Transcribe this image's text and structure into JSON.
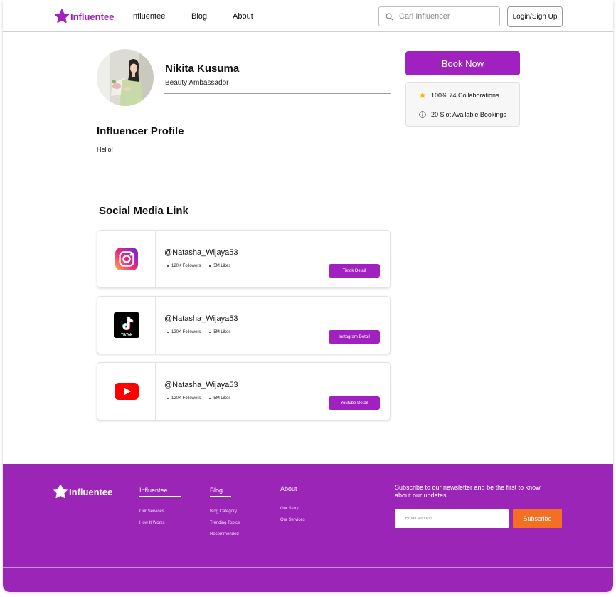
{
  "brand": {
    "name": "Influentee",
    "accent": "#a020c0",
    "footer_bg": "#9b25b6",
    "cta": "#f36f23"
  },
  "nav": {
    "items": [
      "Influentee",
      "Blog",
      "About"
    ]
  },
  "search": {
    "placeholder": "Cari Influencer",
    "icon": "search-icon"
  },
  "auth": {
    "login_label": "Login/Sign Up"
  },
  "profile": {
    "name": "Nikita Kusuma",
    "role": "Beauty Ambassador",
    "section_title": "Influencer Profile",
    "bio": "Hello!"
  },
  "booking": {
    "button_label": "Book Now",
    "stats": [
      {
        "icon": "star-icon",
        "text": "100% 74 Collaborations"
      },
      {
        "icon": "info-icon",
        "text": "20 Slot Available Bookings"
      }
    ]
  },
  "social": {
    "title": "Social Media Link",
    "items": [
      {
        "platform": "instagram",
        "icon": "instagram-icon",
        "handle": "@Natasha_Wijaya53",
        "followers": "120K Followers",
        "likes": "5M Likes",
        "button_label": "Tiktok Detail"
      },
      {
        "platform": "tiktok",
        "icon": "tiktok-icon",
        "handle": "@Natasha_Wijaya53",
        "followers": "120K Followers",
        "likes": "5M Likes",
        "button_label": "Instagram Detail"
      },
      {
        "platform": "youtube",
        "icon": "youtube-icon",
        "handle": "@Natasha_Wijaya53",
        "followers": "120K Followers",
        "likes": "5M Likes",
        "button_label": "Youtube Detail"
      }
    ]
  },
  "footer": {
    "columns": [
      {
        "heading": "Influentee",
        "links": [
          "Our Services",
          "How It Works"
        ]
      },
      {
        "heading": "Blog",
        "links": [
          "Blog Category",
          "Trending Topics",
          "Recommended"
        ]
      },
      {
        "heading": "About",
        "links": [
          "Our Story",
          "Our Services"
        ]
      }
    ],
    "newsletter_text": "Subscribe to our newsletter and be the first to know about our updates",
    "email_placeholder": "Email Address",
    "subscribe_label": "Subscribe"
  }
}
